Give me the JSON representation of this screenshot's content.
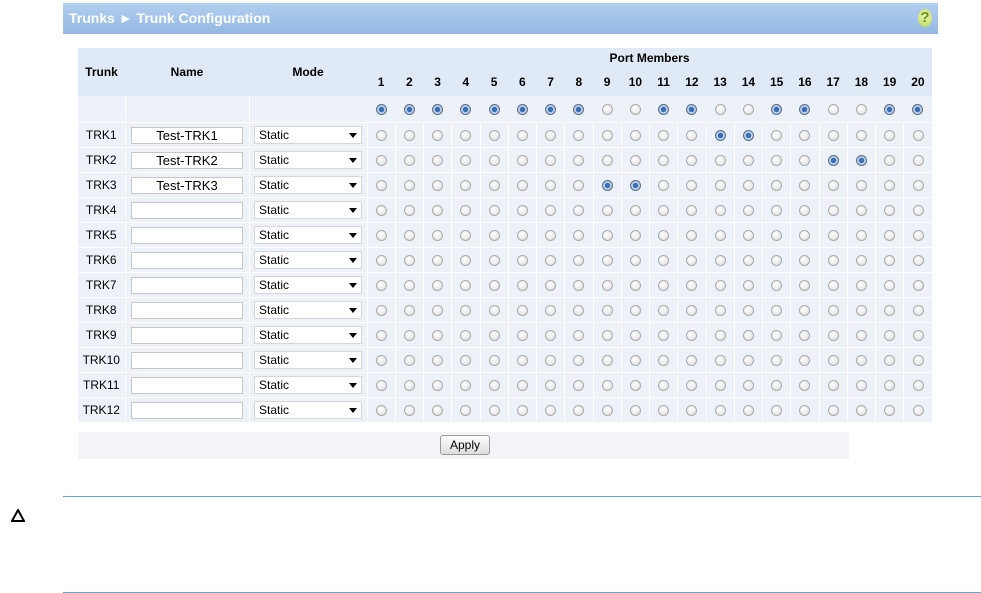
{
  "header": {
    "title": "Trunks ► Trunk Configuration",
    "help_glyph": "?"
  },
  "table": {
    "col_trunk": "Trunk",
    "col_name": "Name",
    "col_mode": "Mode",
    "col_ports": "Port Members",
    "ports": [
      "1",
      "2",
      "3",
      "4",
      "5",
      "6",
      "7",
      "8",
      "9",
      "10",
      "11",
      "12",
      "13",
      "14",
      "15",
      "16",
      "17",
      "18",
      "19",
      "20"
    ],
    "all_row": [
      true,
      true,
      true,
      true,
      true,
      true,
      true,
      true,
      false,
      false,
      true,
      true,
      false,
      false,
      true,
      true,
      false,
      false,
      true,
      true
    ],
    "rows": [
      {
        "trunk": "TRK1",
        "name": "Test-TRK1",
        "mode": "Static",
        "ports": [
          13,
          14
        ]
      },
      {
        "trunk": "TRK2",
        "name": "Test-TRK2",
        "mode": "Static",
        "ports": [
          17,
          18
        ]
      },
      {
        "trunk": "TRK3",
        "name": "Test-TRK3",
        "mode": "Static",
        "ports": [
          9,
          10
        ]
      },
      {
        "trunk": "TRK4",
        "name": "",
        "mode": "Static",
        "ports": []
      },
      {
        "trunk": "TRK5",
        "name": "",
        "mode": "Static",
        "ports": []
      },
      {
        "trunk": "TRK6",
        "name": "",
        "mode": "Static",
        "ports": []
      },
      {
        "trunk": "TRK7",
        "name": "",
        "mode": "Static",
        "ports": []
      },
      {
        "trunk": "TRK8",
        "name": "",
        "mode": "Static",
        "ports": []
      },
      {
        "trunk": "TRK9",
        "name": "",
        "mode": "Static",
        "ports": []
      },
      {
        "trunk": "TRK10",
        "name": "",
        "mode": "Static",
        "ports": []
      },
      {
        "trunk": "TRK11",
        "name": "",
        "mode": "Static",
        "ports": []
      },
      {
        "trunk": "TRK12",
        "name": "",
        "mode": "Static",
        "ports": []
      }
    ]
  },
  "apply_label": "Apply",
  "colors": {
    "header_bg": "#94b8e3",
    "accent": "#3a6fb5",
    "rule": "#6aa4c6"
  },
  "icons": {
    "help": "help-icon",
    "caution": "caution-triangle-icon",
    "dropdown": "chevron-down-icon"
  }
}
